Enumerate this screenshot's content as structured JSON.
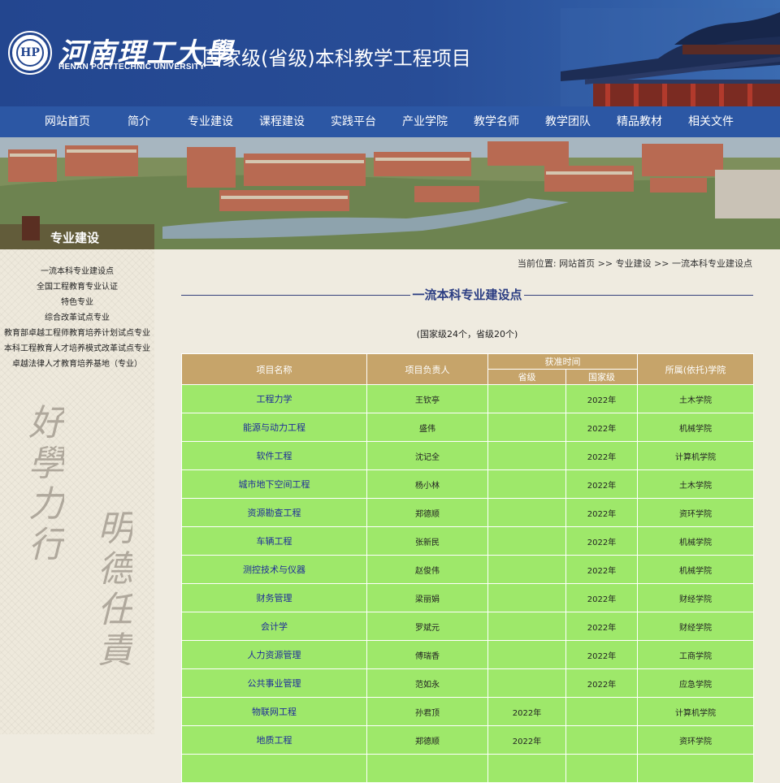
{
  "header": {
    "logo_text_cn": "河南理工大學",
    "logo_text_en": "HENAN POLYTECHNIC UNIVERSITY",
    "title": "国家级(省级)本科教学工程项目"
  },
  "nav": {
    "items": [
      {
        "label": "网站首页"
      },
      {
        "label": "简介"
      },
      {
        "label": "专业建设"
      },
      {
        "label": "课程建设"
      },
      {
        "label": "实践平台"
      },
      {
        "label": "产业学院"
      },
      {
        "label": "教学名师"
      },
      {
        "label": "教学团队"
      },
      {
        "label": "精品教材"
      },
      {
        "label": "相关文件"
      }
    ]
  },
  "banner": {
    "section_label": "专业建设"
  },
  "sidebar": {
    "items": [
      {
        "label": "一流本科专业建设点"
      },
      {
        "label": "全国工程教育专业认证"
      },
      {
        "label": "特色专业"
      },
      {
        "label": "综合改革试点专业"
      },
      {
        "label": "教育部卓越工程师教育培养计划试点专业"
      },
      {
        "label": "本科工程教育人才培养模式改革试点专业"
      },
      {
        "label": "卓越法律人才教育培养基地（专业）"
      }
    ],
    "calligraphy": [
      "好學力行",
      "明德任責"
    ]
  },
  "breadcrumb": {
    "prefix": "当前位置:",
    "home": "网站首页",
    "sep": ">>",
    "section": "专业建设",
    "current": "一流本科专业建设点"
  },
  "main": {
    "heading": "一流本科专业建设点",
    "summary": "(国家级24个，省级20个)"
  },
  "table": {
    "headers": {
      "name": "项目名称",
      "leader": "项目负责人",
      "time": "获准时间",
      "province": "省级",
      "national": "国家级",
      "college": "所属(依托)学院"
    },
    "rows": [
      {
        "name": "工程力学",
        "leader": "王钦亭",
        "province": "",
        "national": "2022年",
        "college": "土木学院"
      },
      {
        "name": "能源与动力工程",
        "leader": "盛伟",
        "province": "",
        "national": "2022年",
        "college": "机械学院"
      },
      {
        "name": "软件工程",
        "leader": "沈记全",
        "province": "",
        "national": "2022年",
        "college": "计算机学院"
      },
      {
        "name": "城市地下空间工程",
        "leader": "杨小林",
        "province": "",
        "national": "2022年",
        "college": "土木学院"
      },
      {
        "name": "资源勘查工程",
        "leader": "郑德顺",
        "province": "",
        "national": "2022年",
        "college": "资环学院"
      },
      {
        "name": "车辆工程",
        "leader": "张新民",
        "province": "",
        "national": "2022年",
        "college": "机械学院"
      },
      {
        "name": "测控技术与仪器",
        "leader": "赵俊伟",
        "province": "",
        "national": "2022年",
        "college": "机械学院"
      },
      {
        "name": "财务管理",
        "leader": "梁丽娟",
        "province": "",
        "national": "2022年",
        "college": "财经学院"
      },
      {
        "name": "会计学",
        "leader": "罗斌元",
        "province": "",
        "national": "2022年",
        "college": "财经学院"
      },
      {
        "name": "人力资源管理",
        "leader": "傅瑞香",
        "province": "",
        "national": "2022年",
        "college": "工商学院"
      },
      {
        "name": "公共事业管理",
        "leader": "范如永",
        "province": "",
        "national": "2022年",
        "college": "应急学院"
      },
      {
        "name": "物联网工程",
        "leader": "孙君顶",
        "province": "2022年",
        "national": "",
        "college": "计算机学院"
      },
      {
        "name": "地质工程",
        "leader": "郑德顺",
        "province": "2022年",
        "national": "",
        "college": "资环学院"
      },
      {
        "name": "",
        "leader": "",
        "province": "",
        "national": "",
        "college": ""
      }
    ]
  }
}
